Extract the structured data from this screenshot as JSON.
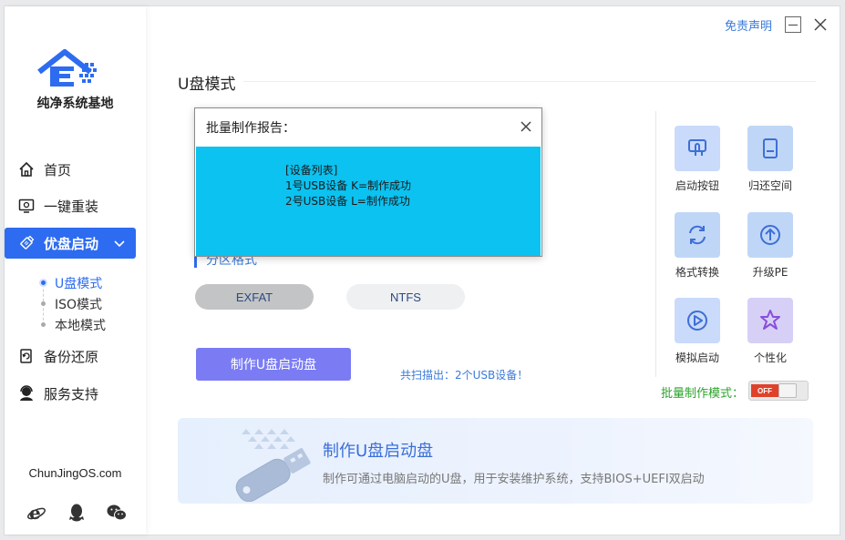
{
  "app": {
    "name": "纯净系统基地",
    "site": "ChunJingOS.com"
  },
  "topbar": {
    "disclaimer": "免责声明"
  },
  "nav": [
    {
      "label": "首页",
      "icon": "home-icon"
    },
    {
      "label": "一键重装",
      "icon": "reinstall-icon"
    },
    {
      "label": "优盘启动",
      "icon": "usb-drive-icon",
      "active": true
    },
    {
      "label": "备份还原",
      "icon": "backup-icon"
    },
    {
      "label": "服务支持",
      "icon": "support-icon"
    }
  ],
  "subnav": [
    {
      "label": "U盘模式",
      "active": true
    },
    {
      "label": "ISO模式"
    },
    {
      "label": "本地模式"
    }
  ],
  "footer_icons": [
    "ie-browser-icon",
    "qq-icon",
    "wechat-icon"
  ],
  "main": {
    "title": "U盘模式",
    "partition_label": "分区格式",
    "formats": [
      {
        "label": "EXFAT",
        "selected": true
      },
      {
        "label": "NTFS",
        "selected": false
      }
    ],
    "make_button": "制作U盘启动盘",
    "scan_info": "共扫描出：2个USB设备！"
  },
  "dialog": {
    "title": "批量制作报告：",
    "lines": [
      "[设备列表]",
      "1号USB设备 K=制作成功",
      "2号USB设备 L=制作成功"
    ]
  },
  "tools": [
    {
      "label": "启动按钮",
      "icon": "boot-button-icon",
      "color": "#c9dafa"
    },
    {
      "label": "归还空间",
      "icon": "restore-space-icon",
      "color": "#c0d6f7"
    },
    {
      "label": "格式转换",
      "icon": "format-convert-icon",
      "color": "#c0d6f7"
    },
    {
      "label": "升级PE",
      "icon": "upgrade-pe-icon",
      "color": "#c0d6f7"
    },
    {
      "label": "模拟启动",
      "icon": "simulate-boot-icon",
      "color": "#c9dafa"
    },
    {
      "label": "个性化",
      "icon": "personalize-icon",
      "color": "#d6d0f7"
    }
  ],
  "batch": {
    "label": "批量制作模式：",
    "toggle": "OFF"
  },
  "banner": {
    "title": "制作U盘启动盘",
    "desc": "制作可通过电脑启动的U盘，用于安装维护系统，支持BIOS+UEFI双启动"
  },
  "colors": {
    "accent": "#2d6cf0",
    "dialog_body": "#0bc2f0",
    "make_button": "#7b7cf4",
    "batch_label": "#2aa32a",
    "toggle_off": "#e0412b"
  }
}
